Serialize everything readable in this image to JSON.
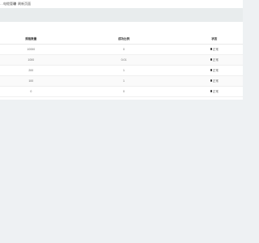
{
  "topbar": {
    "partial_tab_label": "…电缆管理",
    "refresh_tab_label": "刷新页面"
  },
  "table": {
    "headers": [
      "规格数量",
      "成功比例",
      "状态"
    ],
    "rows": [
      {
        "quantity": "10000",
        "ratio": "0",
        "status": "正常"
      },
      {
        "quantity": "1000",
        "ratio": "0.01",
        "status": "正常"
      },
      {
        "quantity": "200",
        "ratio": "1",
        "status": "正常"
      },
      {
        "quantity": "100",
        "ratio": "1",
        "status": "正常"
      },
      {
        "quantity": "0",
        "ratio": "0",
        "status": "正常"
      }
    ]
  }
}
